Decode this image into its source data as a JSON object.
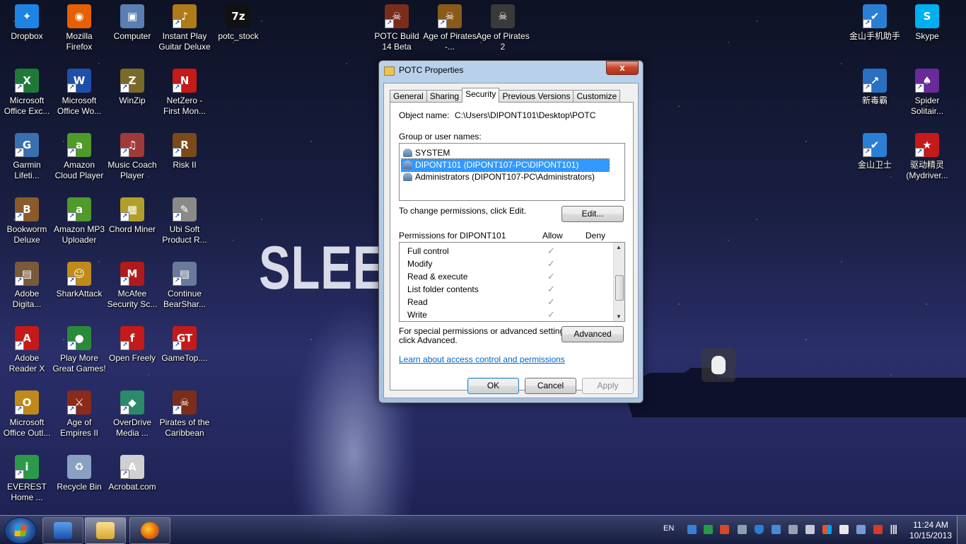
{
  "desktop": {
    "background_text": "SLEEP",
    "icons": [
      {
        "id": "dropbox",
        "label": "Dropbox",
        "color": "#1e84e4",
        "glyph": "✦",
        "shortcut": false
      },
      {
        "id": "firefox",
        "label": "Mozilla Firefox",
        "color": "#e66000",
        "glyph": "◉",
        "shortcut": false
      },
      {
        "id": "computer",
        "label": "Computer",
        "color": "#5a7fb0",
        "glyph": "▣",
        "shortcut": false
      },
      {
        "id": "instant-play",
        "label": "Instant Play Guitar Deluxe",
        "color": "#b07a1a",
        "glyph": "♪",
        "shortcut": true
      },
      {
        "id": "potc-stock",
        "label": "potc_stock",
        "color": "#111111",
        "glyph": "7z",
        "shortcut": false
      },
      {
        "id": "potc-build",
        "label": "POTC Build 14 Beta",
        "color": "#7a2d1a",
        "glyph": "☠",
        "shortcut": true
      },
      {
        "id": "age-of-pirates",
        "label": "Age of Pirates -...",
        "color": "#8a5a1a",
        "glyph": "☠",
        "shortcut": true
      },
      {
        "id": "age-of-pirates-2",
        "label": "Age of Pirates 2",
        "color": "#3a3a3a",
        "glyph": "☠",
        "shortcut": false
      },
      {
        "id": "jinshan-phone",
        "label": "金山手机助手",
        "color": "#2a7fd4",
        "glyph": "✔",
        "shortcut": true
      },
      {
        "id": "skype",
        "label": "Skype",
        "color": "#00aff0",
        "glyph": "S",
        "shortcut": false
      },
      {
        "id": "excel",
        "label": "Microsoft Office Exc...",
        "color": "#1f7a3a",
        "glyph": "X",
        "shortcut": true
      },
      {
        "id": "word",
        "label": "Microsoft Office Wo...",
        "color": "#1f4fa8",
        "glyph": "W",
        "shortcut": true
      },
      {
        "id": "winzip",
        "label": "WinZip",
        "color": "#7a6a2a",
        "glyph": "Z",
        "shortcut": true
      },
      {
        "id": "netzero",
        "label": "NetZero - First Mon...",
        "color": "#c41a1a",
        "glyph": "N",
        "shortcut": true
      },
      {
        "id": "xindubai",
        "label": "新毒霸",
        "color": "#2a6fc0",
        "glyph": "↗",
        "shortcut": true
      },
      {
        "id": "spider",
        "label": "Spider Solitair...",
        "color": "#6a2a9a",
        "glyph": "♠",
        "shortcut": true
      },
      {
        "id": "garmin",
        "label": "Garmin Lifeti...",
        "color": "#3a6fb0",
        "glyph": "G",
        "shortcut": true
      },
      {
        "id": "amazon-cloud",
        "label": "Amazon Cloud Player",
        "color": "#4f9a2a",
        "glyph": "a",
        "shortcut": true
      },
      {
        "id": "music-coach",
        "label": "Music Coach Player",
        "color": "#a03a3a",
        "glyph": "♫",
        "shortcut": true
      },
      {
        "id": "risk",
        "label": "Risk II",
        "color": "#7a4a1a",
        "glyph": "R",
        "shortcut": true
      },
      {
        "id": "jinshan-guard",
        "label": "金山卫士",
        "color": "#2a7fd4",
        "glyph": "✔",
        "shortcut": true
      },
      {
        "id": "qudong",
        "label": "驱动精灵 (Mydriver...",
        "color": "#c41a1a",
        "glyph": "★",
        "shortcut": true
      },
      {
        "id": "bookworm",
        "label": "Bookworm Deluxe",
        "color": "#8a5a2a",
        "glyph": "B",
        "shortcut": true
      },
      {
        "id": "amazon-mp3",
        "label": "Amazon MP3 Uploader",
        "color": "#4f9a2a",
        "glyph": "a",
        "shortcut": true
      },
      {
        "id": "chord-miner",
        "label": "Chord Miner",
        "color": "#b0a02a",
        "glyph": "▦",
        "shortcut": true
      },
      {
        "id": "ubisoft",
        "label": "Ubi Soft Product R...",
        "color": "#8a8a8a",
        "glyph": "✎",
        "shortcut": true
      },
      {
        "id": "adobe-digital",
        "label": "Adobe Digita...",
        "color": "#7a5a3a",
        "glyph": "▤",
        "shortcut": true
      },
      {
        "id": "sharkattack",
        "label": "SharkAttack",
        "color": "#c08a1a",
        "glyph": "☺",
        "shortcut": true
      },
      {
        "id": "mcafee",
        "label": "McAfee Security Sc...",
        "color": "#b01a1a",
        "glyph": "M",
        "shortcut": true
      },
      {
        "id": "bearshare",
        "label": "Continue BearShar...",
        "color": "#6a7a9a",
        "glyph": "▤",
        "shortcut": true
      },
      {
        "id": "adobe-reader",
        "label": "Adobe Reader X",
        "color": "#c41a1a",
        "glyph": "A",
        "shortcut": true
      },
      {
        "id": "play-more",
        "label": "Play More Great Games!",
        "color": "#2a8a3a",
        "glyph": "●",
        "shortcut": true
      },
      {
        "id": "open-freely",
        "label": "Open Freely",
        "color": "#c41a1a",
        "glyph": "f",
        "shortcut": true
      },
      {
        "id": "gametop",
        "label": "GameTop....",
        "color": "#c41a1a",
        "glyph": "GT",
        "shortcut": true
      },
      {
        "id": "outlook",
        "label": "Microsoft Office Outl...",
        "color": "#c08a1a",
        "glyph": "O",
        "shortcut": true
      },
      {
        "id": "age-of-empires",
        "label": "Age of Empires II",
        "color": "#8a2a1a",
        "glyph": "⚔",
        "shortcut": true
      },
      {
        "id": "overdrive",
        "label": "OverDrive Media ...",
        "color": "#2a8a6a",
        "glyph": "◆",
        "shortcut": true
      },
      {
        "id": "potc-game",
        "label": "Pirates of the Caribbean",
        "color": "#7a2d1a",
        "glyph": "☠",
        "shortcut": true
      },
      {
        "id": "everest",
        "label": "EVEREST Home ...",
        "color": "#2a9a4a",
        "glyph": "i",
        "shortcut": true
      },
      {
        "id": "recycle-bin",
        "label": "Recycle Bin",
        "color": "#8aa0c0",
        "glyph": "♻",
        "shortcut": false
      },
      {
        "id": "acrobat-com",
        "label": "Acrobat.com",
        "color": "#d0d0d0",
        "glyph": "A",
        "shortcut": true
      }
    ]
  },
  "dialog": {
    "title": "POTC Properties",
    "close_label": "x",
    "tabs": [
      "General",
      "Sharing",
      "Security",
      "Previous Versions",
      "Customize"
    ],
    "active_tab": "Security",
    "object_name_label": "Object name:",
    "object_name_value": "C:\\Users\\DIPONT101\\Desktop\\POTC",
    "groups_label": "Group or user names:",
    "groups": [
      {
        "name": "SYSTEM",
        "selected": false
      },
      {
        "name": "DIPONT101 (DIPONT107-PC\\DIPONT101)",
        "selected": true
      },
      {
        "name": "Administrators (DIPONT107-PC\\Administrators)",
        "selected": false
      }
    ],
    "change_text": "To change permissions, click Edit.",
    "edit_button": "Edit...",
    "permissions_label": "Permissions for DIPONT101",
    "allow_header": "Allow",
    "deny_header": "Deny",
    "permissions": [
      {
        "name": "Full control",
        "allow": true,
        "deny": false
      },
      {
        "name": "Modify",
        "allow": true,
        "deny": false
      },
      {
        "name": "Read & execute",
        "allow": true,
        "deny": false
      },
      {
        "name": "List folder contents",
        "allow": true,
        "deny": false
      },
      {
        "name": "Read",
        "allow": true,
        "deny": false
      },
      {
        "name": "Write",
        "allow": true,
        "deny": false
      }
    ],
    "check_glyph": "✓",
    "special_text_line1": "For special permissions or advanced settings,",
    "special_text_line2": "click Advanced.",
    "advanced_button": "Advanced",
    "link_text": "Learn about access control and permissions",
    "ok_button": "OK",
    "cancel_button": "Cancel",
    "apply_button": "Apply"
  },
  "taskbar": {
    "language": "EN",
    "time": "11:24 AM",
    "date": "10/15/2013",
    "pinned": [
      "Windows Media Player",
      "Windows Explorer",
      "Mozilla Firefox"
    ]
  },
  "colors": {
    "selection": "#3399ff",
    "link": "#0066cc"
  }
}
